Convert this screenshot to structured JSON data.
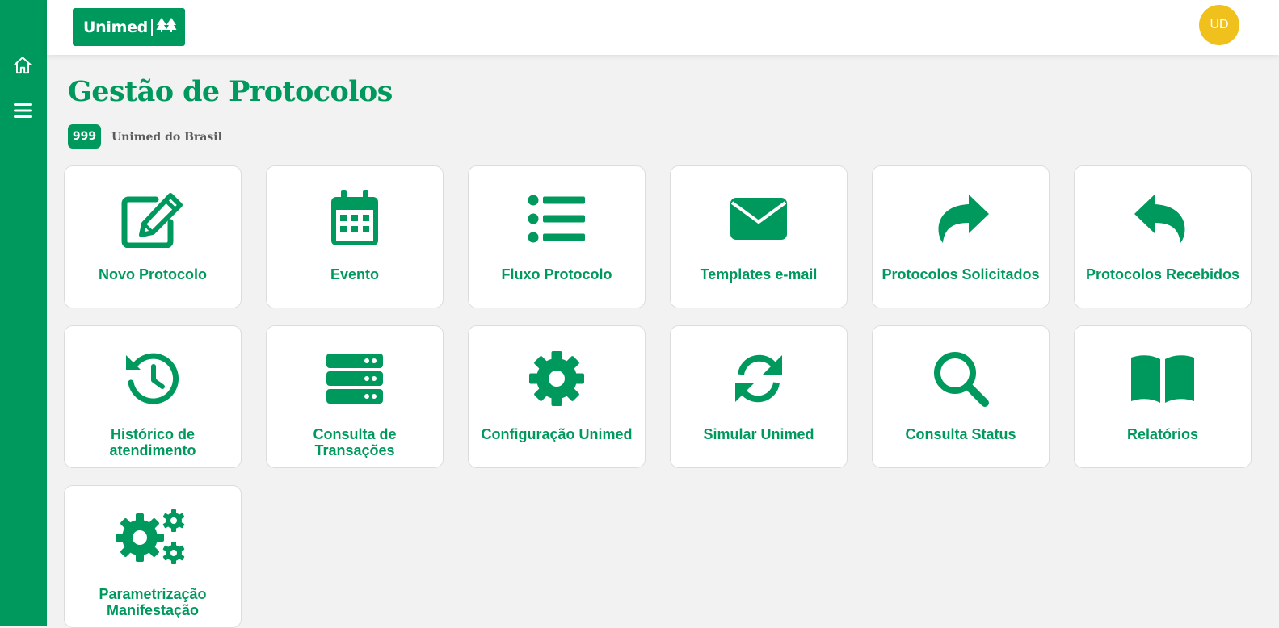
{
  "header": {
    "logo_text": "Unimed",
    "avatar_initials": "UD"
  },
  "page": {
    "title": "Gestão de Protocolos",
    "org_code": "999",
    "org_name": "Unimed do Brasil"
  },
  "colors": {
    "brand_green": "#00995d",
    "avatar_yellow": "#f0c01c",
    "background": "#f2f2f2"
  },
  "sidebar": {
    "items": [
      {
        "icon": "home-icon"
      },
      {
        "icon": "menu-icon"
      }
    ]
  },
  "tiles": [
    {
      "label": "Novo Protocolo",
      "icon": "edit-icon"
    },
    {
      "label": "Evento",
      "icon": "calendar-icon"
    },
    {
      "label": "Fluxo Protocolo",
      "icon": "list-icon"
    },
    {
      "label": "Templates e-mail",
      "icon": "envelope-icon"
    },
    {
      "label": "Protocolos Solicitados",
      "icon": "share-icon"
    },
    {
      "label": "Protocolos Recebidos",
      "icon": "reply-icon"
    },
    {
      "label": "Histórico de atendimento",
      "icon": "history-icon"
    },
    {
      "label": "Consulta de Transações",
      "icon": "server-icon"
    },
    {
      "label": "Configuração Unimed",
      "icon": "gear-icon"
    },
    {
      "label": "Simular Unimed",
      "icon": "sync-icon"
    },
    {
      "label": "Consulta Status",
      "icon": "search-icon"
    },
    {
      "label": "Relatórios",
      "icon": "book-icon"
    },
    {
      "label": "Parametrização Manifestação",
      "icon": "gears-icon"
    }
  ]
}
